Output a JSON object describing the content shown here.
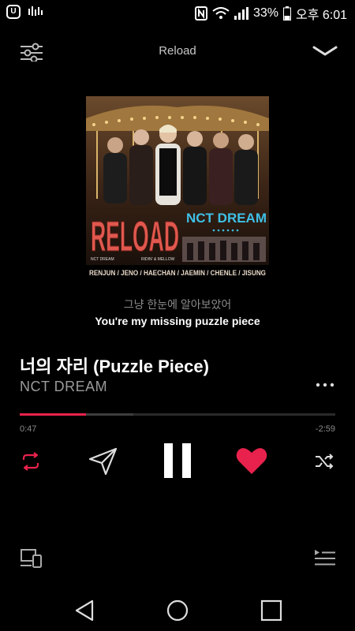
{
  "status_bar": {
    "battery": "33%",
    "time": "오후 6:01",
    "app_letter": "U"
  },
  "header": {
    "title": "Reload"
  },
  "album": {
    "cover_title": "RELOAD",
    "cover_artist": "NCT DREAM",
    "members": "RENJUN / JENO / HAECHAN / JAEMIN / CHENLE / JISUNG",
    "small_left": "NCT DREAM",
    "small_right": "RIDIN' & MELLOW"
  },
  "lyrics": {
    "previous": "그냥 한눈에 알아보았어",
    "current": "You're my missing puzzle piece"
  },
  "track": {
    "title": "너의 자리 (Puzzle Piece)",
    "artist": "NCT DREAM"
  },
  "playback": {
    "elapsed": "0:47",
    "remaining": "-2:59",
    "progress": 0.21,
    "buffered": 0.36
  },
  "colors": {
    "accent": "#e8224c",
    "background": "#000000"
  },
  "icons": {
    "repeat": "repeat-icon",
    "share": "send-icon",
    "play_pause": "pause-icon",
    "like": "heart-icon",
    "shuffle": "shuffle-icon",
    "device": "devices-icon",
    "queue": "queue-icon"
  }
}
